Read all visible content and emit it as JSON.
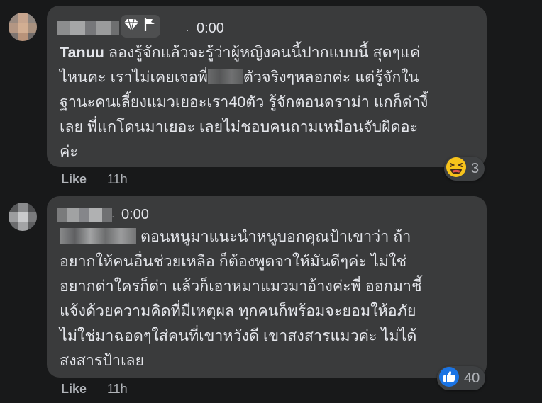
{
  "comments": [
    {
      "author": "Tanuu",
      "time": "0:00",
      "lines": [
        "ลองรู้จักแล้วจะรู้ว่าผู้หญิงคนนี้ปากแบบนี้ สุดๆแค่",
        "ไหนคะ เราไม่เคยเจอพี่",
        "ตัวจริงๆหลอกค่ะ แต่รู้จักใน",
        "ฐานะคนเลี้ยงแมวเยอะเรา40ตัว รู้จักตอนดราม่า แกก็ด่างี้",
        "เลย พี่แกโดนมาเยอะ เลยไม่ชอบคนถามเหมือนจับผิดอะ",
        "ค่ะ"
      ],
      "like_label": "Like",
      "age": "11h",
      "reaction_icon": "laughing-emoji-icon",
      "reaction_count": "3"
    },
    {
      "time": "0:00",
      "lines": [
        "ตอนหนูมาแนะนำหนูบอกคุณป้าเขาว่า ถ้า",
        "อยากให้คนอื่นช่วยเหลือ ก็ต้องพูดจาให้มันดีๆค่ะ ไม่ใช่",
        "อยากด่าใครก็ด่า แล้วก็เอาหมาแมวมาอ้างค่ะพี่ ออกมาชี้",
        "แจ้งด้วยความคิดที่มีเหตุผล ทุกคนก็พร้อมจะยอมให้อภัย",
        "ไม่ใช่มาฉอดๆใส่คนที่เขาหวังดี เขาสงสารแมวค่ะ ไม่ได้",
        "สงสารป้าเลย"
      ],
      "like_label": "Like",
      "age": "11h",
      "reaction_icon": "thumbs-up-icon",
      "reaction_count": "40"
    }
  ],
  "badge_icons": [
    "diamond-icon",
    "flag-icon"
  ],
  "separator": "·"
}
